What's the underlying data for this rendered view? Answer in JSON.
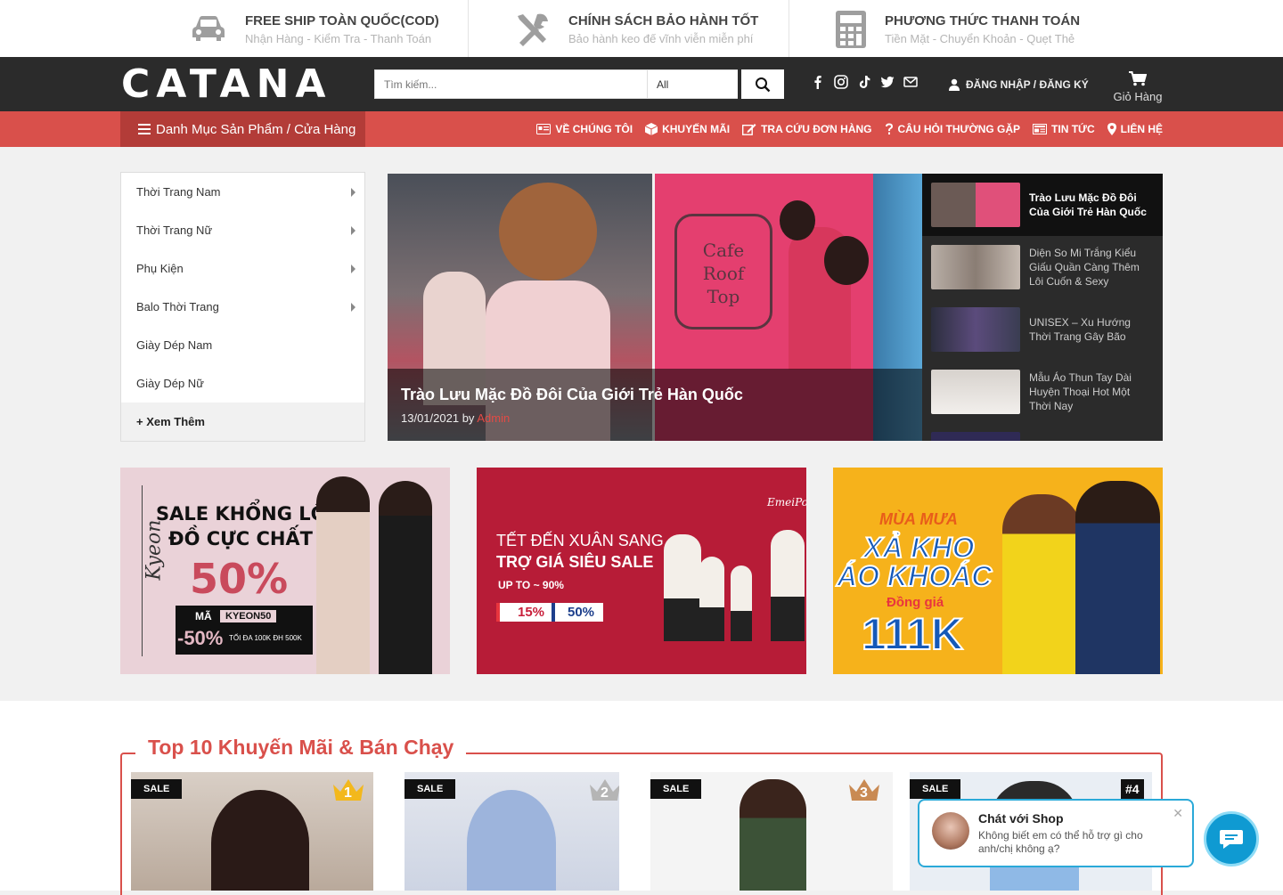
{
  "topinfo": [
    {
      "icon": "car-icon",
      "title": "FREE SHIP TOÀN QUỐC(COD)",
      "sub": "Nhận Hàng - Kiểm Tra - Thanh Toán"
    },
    {
      "icon": "tools-icon",
      "title": "CHÍNH SÁCH BẢO HÀNH TỐT",
      "sub": "Bảo hành keo đế vĩnh viễn miễn phí"
    },
    {
      "icon": "calculator-icon",
      "title": "PHƯƠNG THỨC THANH TOÁN",
      "sub": "Tiền Mặt - Chuyển Khoản - Quẹt Thẻ"
    }
  ],
  "header": {
    "logo": "CATANA",
    "search_placeholder": "Tìm kiếm...",
    "search_category": "All",
    "login": "ĐĂNG NHẬP / ĐĂNG KÝ",
    "cart": "Giỏ Hàng"
  },
  "nav": {
    "category_button": "Danh Mục Sản Phẩm / Cửa Hàng",
    "items": [
      {
        "icon": "id-card-icon",
        "label": "VỀ CHÚNG TÔI"
      },
      {
        "icon": "box-icon",
        "label": "KHUYẾN MÃI"
      },
      {
        "icon": "edit-icon",
        "label": "TRA CỨU ĐƠN HÀNG"
      },
      {
        "icon": "question-icon",
        "label": "CÂU HỎI THƯỜNG GẶP"
      },
      {
        "icon": "newspaper-icon",
        "label": "TIN TỨC"
      },
      {
        "icon": "map-marker-icon",
        "label": "LIÊN HỆ"
      }
    ]
  },
  "sidebar": {
    "items": [
      {
        "label": "Thời Trang Nam",
        "has_sub": true
      },
      {
        "label": "Thời Trang Nữ",
        "has_sub": true
      },
      {
        "label": "Phụ Kiện",
        "has_sub": true
      },
      {
        "label": "Balo Thời Trang",
        "has_sub": true
      },
      {
        "label": "Giày Dép Nam",
        "has_sub": false
      },
      {
        "label": "Giày Dép Nữ",
        "has_sub": false
      }
    ],
    "more": "+ Xem Thêm"
  },
  "slider": {
    "title": "Trào Lưu Mặc Đồ Đôi Của Giới Trẻ Hàn Quốc",
    "date": "13/01/2021",
    "by": "by",
    "author": "Admin",
    "sign_text": "Cafe Roof Top"
  },
  "posts": [
    {
      "title": "Trào Lưu Mặc Đồ Đôi Của Giới Trẻ Hàn Quốc",
      "active": true,
      "color": "#d65b7f"
    },
    {
      "title": "Diện So Mi Trắng Kiểu Giấu Quần Càng Thêm Lôi Cuốn & Sexy",
      "active": false,
      "color": "#9b8f88"
    },
    {
      "title": "UNISEX – Xu Hướng Thời Trang Gây Bão",
      "active": false,
      "color": "#3c3f5a"
    },
    {
      "title": "Mẫu Áo Thun Tay Dài Huyện Thoại Hot Một Thời Nay",
      "active": false,
      "color": "#c9c3bd"
    }
  ],
  "banners": [
    {
      "brand": "Kyeon",
      "line1": "SALE KHỔNG LỒ",
      "line2": "ĐỒ CỰC CHẤT",
      "percent": "50%",
      "code_label": "MÃ",
      "code": "KYEON50",
      "discount": "-50%",
      "note": "TỐI ĐA 100K ĐH 500K"
    },
    {
      "brand": "EmeiPo",
      "line1": "TẾT ĐẾN XUÂN SANG",
      "line2": "TRỢ GIÁ SIÊU SALE",
      "upto": "UP TO ~ 90%",
      "v1": "15%",
      "v2": "50%"
    },
    {
      "line1": "MÙA MƯA",
      "line2": "XẢ KHO",
      "line3": "ÁO KHOÁC",
      "line4": "Đồng giá",
      "price": "111K"
    }
  ],
  "section": {
    "title": "Top 10 Khuyến Mãi & Bán Chạy",
    "products": [
      {
        "badge": "SALE",
        "rank": "1"
      },
      {
        "badge": "SALE",
        "rank": "2"
      },
      {
        "badge": "SALE",
        "rank": "3"
      },
      {
        "badge": "SALE",
        "rank": "#4"
      }
    ]
  },
  "chat": {
    "title": "Chát với Shop",
    "message": "Không biết em có thể hỗ trợ gì cho anh/chị không ạ?"
  },
  "colors": {
    "primary": "#d9504b",
    "dark": "#2b2b2b",
    "chat": "#0f9ad2"
  }
}
